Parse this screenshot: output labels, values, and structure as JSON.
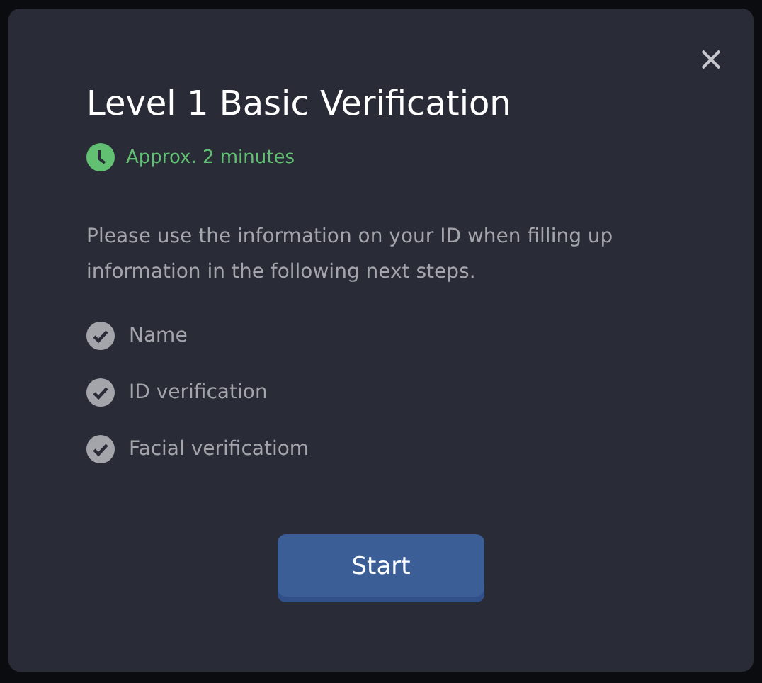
{
  "dialog": {
    "title": "Level 1 Basic Verification",
    "duration": "Approx. 2 minutes",
    "description": "Please use the information on your ID when filling up information in the following next steps.",
    "steps": [
      {
        "label": "Name"
      },
      {
        "label": "ID verification"
      },
      {
        "label": "Facial verificatiom"
      }
    ],
    "button": "Start"
  }
}
